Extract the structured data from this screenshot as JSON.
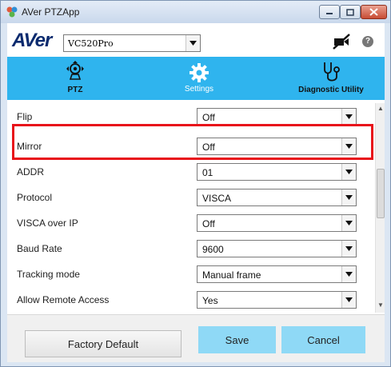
{
  "window": {
    "title": "AVer PTZApp"
  },
  "header": {
    "logo": "AVer",
    "model": "VC520Pro",
    "help": "?"
  },
  "tabs": [
    {
      "id": "ptz",
      "label": "PTZ",
      "icon": "camera-icon",
      "active": false
    },
    {
      "id": "settings",
      "label": "Settings",
      "icon": "gear-icon",
      "active": true
    },
    {
      "id": "diagnostic",
      "label": "Diagnostic Utility",
      "icon": "stethoscope-icon",
      "active": false
    }
  ],
  "settings": [
    {
      "label": "Flip",
      "value": "Off"
    },
    {
      "label": "Mirror",
      "value": "Off"
    },
    {
      "label": "ADDR",
      "value": "01"
    },
    {
      "label": "Protocol",
      "value": "VISCA"
    },
    {
      "label": "VISCA over IP",
      "value": "Off"
    },
    {
      "label": "Baud Rate",
      "value": "9600"
    },
    {
      "label": "Tracking mode",
      "value": "Manual frame"
    },
    {
      "label": "Allow Remote Access",
      "value": "Yes"
    }
  ],
  "footer": {
    "factory_default": "Factory Default",
    "save": "Save",
    "cancel": "Cancel"
  },
  "colors": {
    "accent": "#2fb4ee",
    "highlight": "#e8111a",
    "button": "#8fd9f6"
  }
}
